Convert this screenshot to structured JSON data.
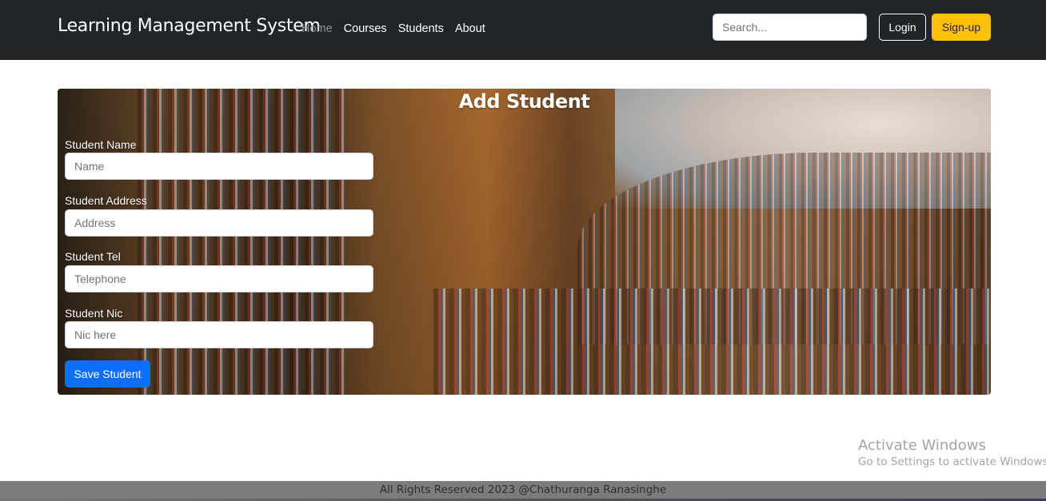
{
  "navbar": {
    "brand": "Learning Management System",
    "links": [
      "Home",
      "Courses",
      "Students",
      "About"
    ],
    "search_placeholder": "Search...",
    "login_label": "Login",
    "signup_label": "Sign-up"
  },
  "form": {
    "title": "Add Student",
    "fields": [
      {
        "label": "Student Name",
        "placeholder": "Name"
      },
      {
        "label": "Student Address",
        "placeholder": "Address"
      },
      {
        "label": "Student Tel",
        "placeholder": "Telephone"
      },
      {
        "label": "Student Nic",
        "placeholder": "Nic here"
      }
    ],
    "save_label": "Save Student"
  },
  "watermark": {
    "title": "Activate Windows",
    "subtitle": "Go to Settings to activate Windows."
  },
  "footer": {
    "text": "All Rights Reserved 2023 @Chathuranga Ranasinghe"
  },
  "colors": {
    "navbar_bg": "#212529",
    "signup_accent": "#ffc107",
    "primary_button": "#0d6efd",
    "footer_bg": "#7c7c7c"
  }
}
